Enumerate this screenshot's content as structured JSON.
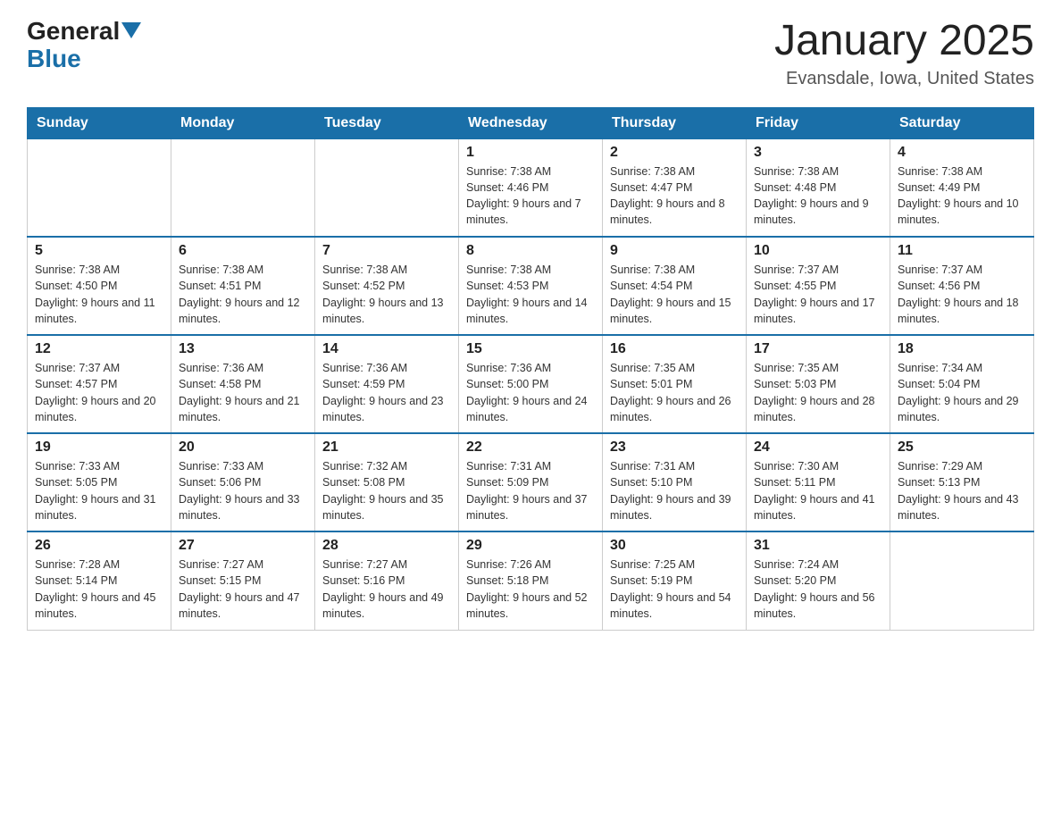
{
  "header": {
    "logo": {
      "general": "General",
      "blue": "Blue"
    },
    "title": "January 2025",
    "subtitle": "Evansdale, Iowa, United States"
  },
  "days_of_week": [
    "Sunday",
    "Monday",
    "Tuesday",
    "Wednesday",
    "Thursday",
    "Friday",
    "Saturday"
  ],
  "weeks": [
    [
      {
        "day": "",
        "info": ""
      },
      {
        "day": "",
        "info": ""
      },
      {
        "day": "",
        "info": ""
      },
      {
        "day": "1",
        "info": "Sunrise: 7:38 AM\nSunset: 4:46 PM\nDaylight: 9 hours and 7 minutes."
      },
      {
        "day": "2",
        "info": "Sunrise: 7:38 AM\nSunset: 4:47 PM\nDaylight: 9 hours and 8 minutes."
      },
      {
        "day": "3",
        "info": "Sunrise: 7:38 AM\nSunset: 4:48 PM\nDaylight: 9 hours and 9 minutes."
      },
      {
        "day": "4",
        "info": "Sunrise: 7:38 AM\nSunset: 4:49 PM\nDaylight: 9 hours and 10 minutes."
      }
    ],
    [
      {
        "day": "5",
        "info": "Sunrise: 7:38 AM\nSunset: 4:50 PM\nDaylight: 9 hours and 11 minutes."
      },
      {
        "day": "6",
        "info": "Sunrise: 7:38 AM\nSunset: 4:51 PM\nDaylight: 9 hours and 12 minutes."
      },
      {
        "day": "7",
        "info": "Sunrise: 7:38 AM\nSunset: 4:52 PM\nDaylight: 9 hours and 13 minutes."
      },
      {
        "day": "8",
        "info": "Sunrise: 7:38 AM\nSunset: 4:53 PM\nDaylight: 9 hours and 14 minutes."
      },
      {
        "day": "9",
        "info": "Sunrise: 7:38 AM\nSunset: 4:54 PM\nDaylight: 9 hours and 15 minutes."
      },
      {
        "day": "10",
        "info": "Sunrise: 7:37 AM\nSunset: 4:55 PM\nDaylight: 9 hours and 17 minutes."
      },
      {
        "day": "11",
        "info": "Sunrise: 7:37 AM\nSunset: 4:56 PM\nDaylight: 9 hours and 18 minutes."
      }
    ],
    [
      {
        "day": "12",
        "info": "Sunrise: 7:37 AM\nSunset: 4:57 PM\nDaylight: 9 hours and 20 minutes."
      },
      {
        "day": "13",
        "info": "Sunrise: 7:36 AM\nSunset: 4:58 PM\nDaylight: 9 hours and 21 minutes."
      },
      {
        "day": "14",
        "info": "Sunrise: 7:36 AM\nSunset: 4:59 PM\nDaylight: 9 hours and 23 minutes."
      },
      {
        "day": "15",
        "info": "Sunrise: 7:36 AM\nSunset: 5:00 PM\nDaylight: 9 hours and 24 minutes."
      },
      {
        "day": "16",
        "info": "Sunrise: 7:35 AM\nSunset: 5:01 PM\nDaylight: 9 hours and 26 minutes."
      },
      {
        "day": "17",
        "info": "Sunrise: 7:35 AM\nSunset: 5:03 PM\nDaylight: 9 hours and 28 minutes."
      },
      {
        "day": "18",
        "info": "Sunrise: 7:34 AM\nSunset: 5:04 PM\nDaylight: 9 hours and 29 minutes."
      }
    ],
    [
      {
        "day": "19",
        "info": "Sunrise: 7:33 AM\nSunset: 5:05 PM\nDaylight: 9 hours and 31 minutes."
      },
      {
        "day": "20",
        "info": "Sunrise: 7:33 AM\nSunset: 5:06 PM\nDaylight: 9 hours and 33 minutes."
      },
      {
        "day": "21",
        "info": "Sunrise: 7:32 AM\nSunset: 5:08 PM\nDaylight: 9 hours and 35 minutes."
      },
      {
        "day": "22",
        "info": "Sunrise: 7:31 AM\nSunset: 5:09 PM\nDaylight: 9 hours and 37 minutes."
      },
      {
        "day": "23",
        "info": "Sunrise: 7:31 AM\nSunset: 5:10 PM\nDaylight: 9 hours and 39 minutes."
      },
      {
        "day": "24",
        "info": "Sunrise: 7:30 AM\nSunset: 5:11 PM\nDaylight: 9 hours and 41 minutes."
      },
      {
        "day": "25",
        "info": "Sunrise: 7:29 AM\nSunset: 5:13 PM\nDaylight: 9 hours and 43 minutes."
      }
    ],
    [
      {
        "day": "26",
        "info": "Sunrise: 7:28 AM\nSunset: 5:14 PM\nDaylight: 9 hours and 45 minutes."
      },
      {
        "day": "27",
        "info": "Sunrise: 7:27 AM\nSunset: 5:15 PM\nDaylight: 9 hours and 47 minutes."
      },
      {
        "day": "28",
        "info": "Sunrise: 7:27 AM\nSunset: 5:16 PM\nDaylight: 9 hours and 49 minutes."
      },
      {
        "day": "29",
        "info": "Sunrise: 7:26 AM\nSunset: 5:18 PM\nDaylight: 9 hours and 52 minutes."
      },
      {
        "day": "30",
        "info": "Sunrise: 7:25 AM\nSunset: 5:19 PM\nDaylight: 9 hours and 54 minutes."
      },
      {
        "day": "31",
        "info": "Sunrise: 7:24 AM\nSunset: 5:20 PM\nDaylight: 9 hours and 56 minutes."
      },
      {
        "day": "",
        "info": ""
      }
    ]
  ]
}
